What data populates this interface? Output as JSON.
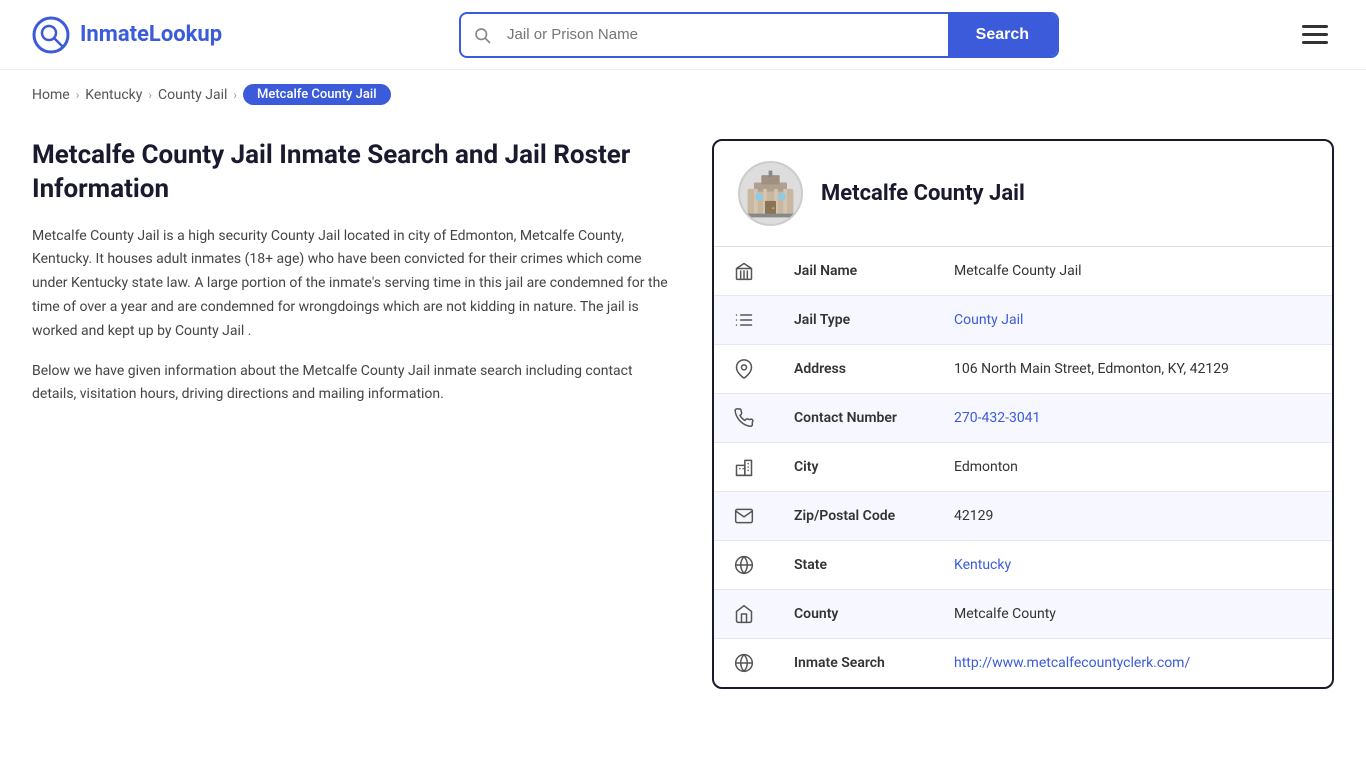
{
  "header": {
    "logo_brand": "InmateLookup",
    "logo_brand_first": "Inmate",
    "logo_brand_second": "Lookup",
    "search_placeholder": "Jail or Prison Name",
    "search_button_label": "Search"
  },
  "breadcrumb": {
    "home": "Home",
    "state": "Kentucky",
    "type": "County Jail",
    "current": "Metcalfe County Jail"
  },
  "left": {
    "heading": "Metcalfe County Jail Inmate Search and Jail Roster Information",
    "description1": "Metcalfe County Jail is a high security County Jail located in city of Edmonton, Metcalfe County, Kentucky. It houses adult inmates (18+ age) who have been convicted for their crimes which come under Kentucky state law. A large portion of the inmate's serving time in this jail are condemned for the time of over a year and are condemned for wrongdoings which are not kidding in nature. The jail is worked and kept up by County Jail .",
    "description2": "Below we have given information about the Metcalfe County Jail inmate search including contact details, visitation hours, driving directions and mailing information."
  },
  "card": {
    "title": "Metcalfe County Jail",
    "rows": [
      {
        "label": "Jail Name",
        "value": "Metcalfe County Jail",
        "link": null,
        "icon": "jail-icon"
      },
      {
        "label": "Jail Type",
        "value": "County Jail",
        "link": "#",
        "icon": "list-icon"
      },
      {
        "label": "Address",
        "value": "106 North Main Street, Edmonton, KY, 42129",
        "link": null,
        "icon": "location-icon"
      },
      {
        "label": "Contact Number",
        "value": "270-432-3041",
        "link": "tel:270-432-3041",
        "icon": "phone-icon"
      },
      {
        "label": "City",
        "value": "Edmonton",
        "link": null,
        "icon": "city-icon"
      },
      {
        "label": "Zip/Postal Code",
        "value": "42129",
        "link": null,
        "icon": "mail-icon"
      },
      {
        "label": "State",
        "value": "Kentucky",
        "link": "#",
        "icon": "globe-icon"
      },
      {
        "label": "County",
        "value": "Metcalfe County",
        "link": null,
        "icon": "county-icon"
      },
      {
        "label": "Inmate Search",
        "value": "http://www.metcalfecountyclerk.com/",
        "link": "http://www.metcalfecountyclerk.com/",
        "icon": "search-globe-icon"
      }
    ]
  }
}
